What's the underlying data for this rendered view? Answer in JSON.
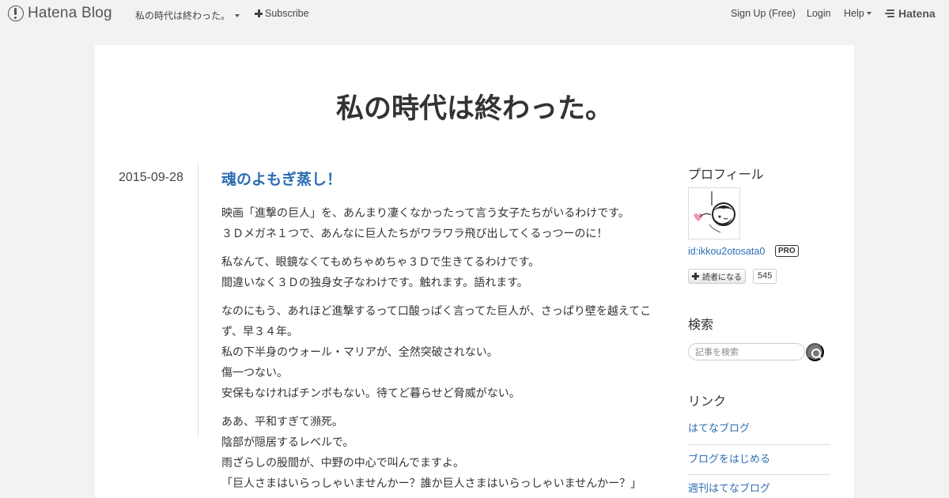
{
  "global_header": {
    "logo_text": "Hatena Blog",
    "blog_name": "私の時代は終わった。",
    "subscribe_label": "Subscribe",
    "signup_label": "Sign Up (Free)",
    "login_label": "Login",
    "help_label": "Help",
    "hatena_label": "Hatena"
  },
  "blog": {
    "title": "私の時代は終わった。"
  },
  "entry": {
    "date": "2015-09-28",
    "title": "魂のよもぎ蒸し！",
    "paragraphs": [
      [
        "映画「進撃の巨人」を、あんまり凄くなかったって言う女子たちがいるわけです。",
        "３Ｄメガネ１つで、あんなに巨人たちがワラワラ飛び出してくるっつーのに！"
      ],
      [
        "私なんて、眼鏡なくてもめちゃめちゃ３Ｄで生きてるわけです。",
        "間違いなく３Ｄの独身女子なわけです。触れます。語れます。"
      ],
      [
        "なのにもう、あれほど進撃するって口酸っぱく言ってた巨人が、さっぱり壁を越えてこず、早３４年。",
        "私の下半身のウォール・マリアが、全然突破されない。",
        "傷一つない。",
        "安保もなければチンポもない。待てど暮らせど脅威がない。"
      ],
      [
        "ああ、平和すぎて瀕死。",
        "陰部が隠居するレベルで。",
        "雨ざらしの股間が、中野の中心で叫んでますよ。",
        "「巨人さまはいらっしゃいませんかー？誰か巨人さまはいらっしゃいませんかー？」"
      ]
    ]
  },
  "sidebar": {
    "profile_heading": "プロフィール",
    "profile_id": "id:ikkou2otosata0",
    "pro_badge": "PRO",
    "reader_button_label": "読者になる",
    "reader_count": "545",
    "search_heading": "検索",
    "search_placeholder": "記事を検索",
    "links_heading": "リンク",
    "links": [
      "はてなブログ",
      "ブログをはじめる",
      "週刊はてなブログ"
    ]
  },
  "colors": {
    "link": "#2d6eb3",
    "background": "#f2f2f2",
    "content_bg": "#ffffff"
  }
}
